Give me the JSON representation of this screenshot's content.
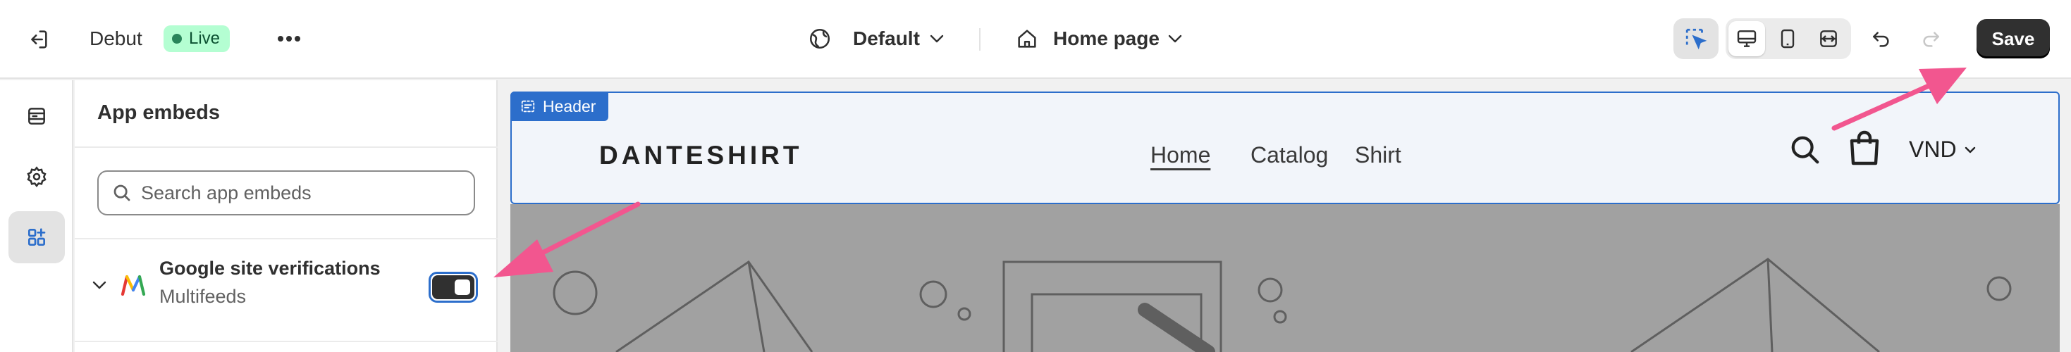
{
  "topbar": {
    "exit_icon": "exit-icon",
    "theme_name": "Debut",
    "status_badge": "Live",
    "more_icon": "more-horizontal-icon",
    "theme_selector": "Default",
    "page_selector": "Home page",
    "tools": [
      "inspector-select-icon",
      "desktop-view-icon",
      "mobile-view-icon",
      "fullwidth-view-icon",
      "undo-icon",
      "redo-icon"
    ],
    "save_label": "Save"
  },
  "rail": {
    "items": [
      "sections-icon",
      "settings-icon",
      "app-embeds-icon"
    ],
    "active_index": 2
  },
  "panel": {
    "title": "App embeds",
    "search_placeholder": "Search app embeds",
    "embed": {
      "name": "Google site verifications",
      "provider": "Multifeeds",
      "enabled": true
    }
  },
  "preview": {
    "header_tag": "Header",
    "store_name": "DANTESHIRT",
    "nav": [
      "Home",
      "Catalog",
      "Shirt"
    ],
    "active_nav": "Home",
    "currency": "VND"
  },
  "colors": {
    "accent": "#2c6ecb",
    "live_badge_bg": "#b4fed2",
    "save_bg": "#303030",
    "annotation_arrow": "#f2568f"
  }
}
